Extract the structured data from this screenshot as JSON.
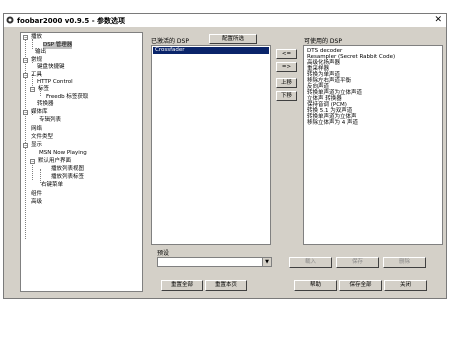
{
  "window": {
    "title": "foobar2000 v0.9.5 - 参数选项",
    "close_glyph": "✕"
  },
  "tree": [
    {
      "label": "播放",
      "expander": "−"
    },
    {
      "label": "DSP 管理器",
      "selected": true
    },
    {
      "label": "输出"
    },
    {
      "label": "常规",
      "expander": "−"
    },
    {
      "label": "键盘快捷键"
    },
    {
      "label": "工具",
      "expander": "−"
    },
    {
      "label": "HTTP Control"
    },
    {
      "label": "标签",
      "expander": "−"
    },
    {
      "label": "Freedb 标签获取"
    },
    {
      "label": "转换器"
    },
    {
      "label": "媒体库",
      "expander": "−"
    },
    {
      "label": "专辑列表"
    },
    {
      "label": "网络"
    },
    {
      "label": "文件类型"
    },
    {
      "label": "显示",
      "expander": "−"
    },
    {
      "label": "MSN Now Playing"
    },
    {
      "label": "默认用户界面",
      "expander": "−"
    },
    {
      "label": "播放列表视图"
    },
    {
      "label": "播放列表标签"
    },
    {
      "label": "右键菜单"
    },
    {
      "label": "组件"
    },
    {
      "label": "高级"
    }
  ],
  "dsp": {
    "active_label": "已激活的 DSP",
    "preset_button": "配置所选",
    "active_items": [
      "Crossfader"
    ],
    "available_label": "可使用的 DSP",
    "available_items": [
      "DTS decoder",
      "Resampler (Secret Rabbit Code)",
      "高级化扬声器",
      "重采样器",
      "转换为单声道",
      "移除左右声道平衡",
      "反向声道",
      "转换单声道为立体声道",
      "立体声 转换器",
      "保持音调 (PCM)",
      "转换 5.1 为双声道",
      "转换单声道为立体声",
      "移除立体声为 4 声道"
    ],
    "move_buttons": [
      "<=",
      "=>",
      "上移",
      "下移"
    ]
  },
  "presets": {
    "label": "预设",
    "value": "",
    "load_button": "载入",
    "save_button": "保存",
    "delete_button": "删除"
  },
  "footer": {
    "reset_all": "重置全部",
    "reset_page": "重置本页",
    "help": "帮助",
    "save_all": "保存全部",
    "close": "关闭"
  }
}
